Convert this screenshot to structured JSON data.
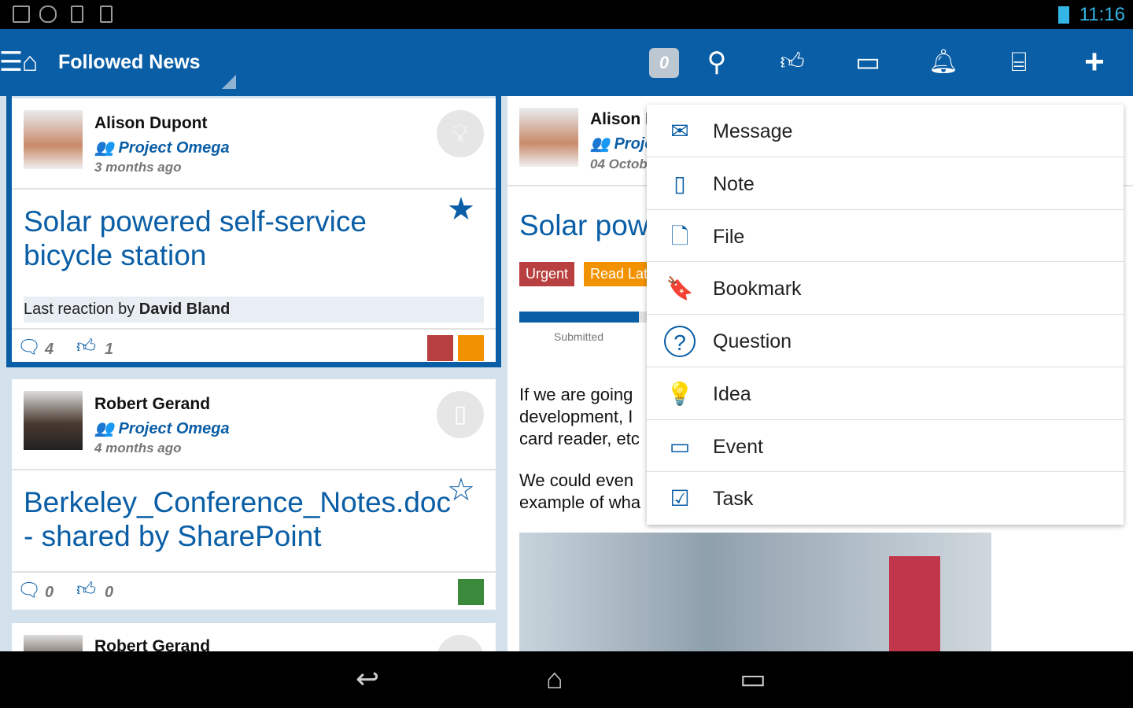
{
  "status": {
    "time": "11:16",
    "icons": [
      "image-icon",
      "cloud-upload-icon",
      "download-icon",
      "download-icon",
      "wifi-icon",
      "battery-icon"
    ]
  },
  "actionbar": {
    "title": "Followed News",
    "badge": "0",
    "icons": [
      "menu-icon",
      "home-icon",
      "search-icon",
      "thumbs-up-icon",
      "comment-icon",
      "bell-icon",
      "inbox-icon",
      "plus-icon"
    ]
  },
  "feed": [
    {
      "author": "Alison Dupont",
      "project": "Project Omega",
      "time": "3 months ago",
      "title": "Solar powered self-service bicycle station",
      "reaction_prefix": "Last reaction by ",
      "reaction_user": "David Bland",
      "comments": "4",
      "likes": "1",
      "tags": [
        "#b94040",
        "#f39200"
      ]
    },
    {
      "author": "Robert Gerand",
      "project": "Project Omega",
      "time": "4 months ago",
      "title": "Berkeley_Conference_Notes.doc - shared by SharePoint",
      "comments": "0",
      "likes": "0",
      "tags": [
        "#3b8a3b"
      ]
    },
    {
      "author": "Robert Gerand"
    }
  ],
  "detail": {
    "author": "Alison D",
    "project": "Proje",
    "date": "04 Octob",
    "title": "Solar powe",
    "tags": [
      {
        "label": "Urgent",
        "color": "#b94040"
      },
      {
        "label": "Read Lat",
        "color": "#f39200"
      }
    ],
    "progress_label": "Submitted",
    "body1": "If we are going\ndevelopment, I\ncard reader, etc",
    "body2": "We could even\nexample of wha"
  },
  "menu": [
    {
      "label": "Message",
      "icon": "envelope-icon",
      "glyph": "✉"
    },
    {
      "label": "Note",
      "icon": "note-icon",
      "glyph": "▯"
    },
    {
      "label": "File",
      "icon": "file-icon",
      "glyph": "🗋"
    },
    {
      "label": "Bookmark",
      "icon": "bookmark-icon",
      "glyph": "🔖"
    },
    {
      "label": "Question",
      "icon": "question-icon",
      "glyph": "?"
    },
    {
      "label": "Idea",
      "icon": "lightbulb-icon",
      "glyph": "💡"
    },
    {
      "label": "Event",
      "icon": "calendar-icon",
      "glyph": "▭"
    },
    {
      "label": "Task",
      "icon": "task-icon",
      "glyph": "☑"
    }
  ]
}
